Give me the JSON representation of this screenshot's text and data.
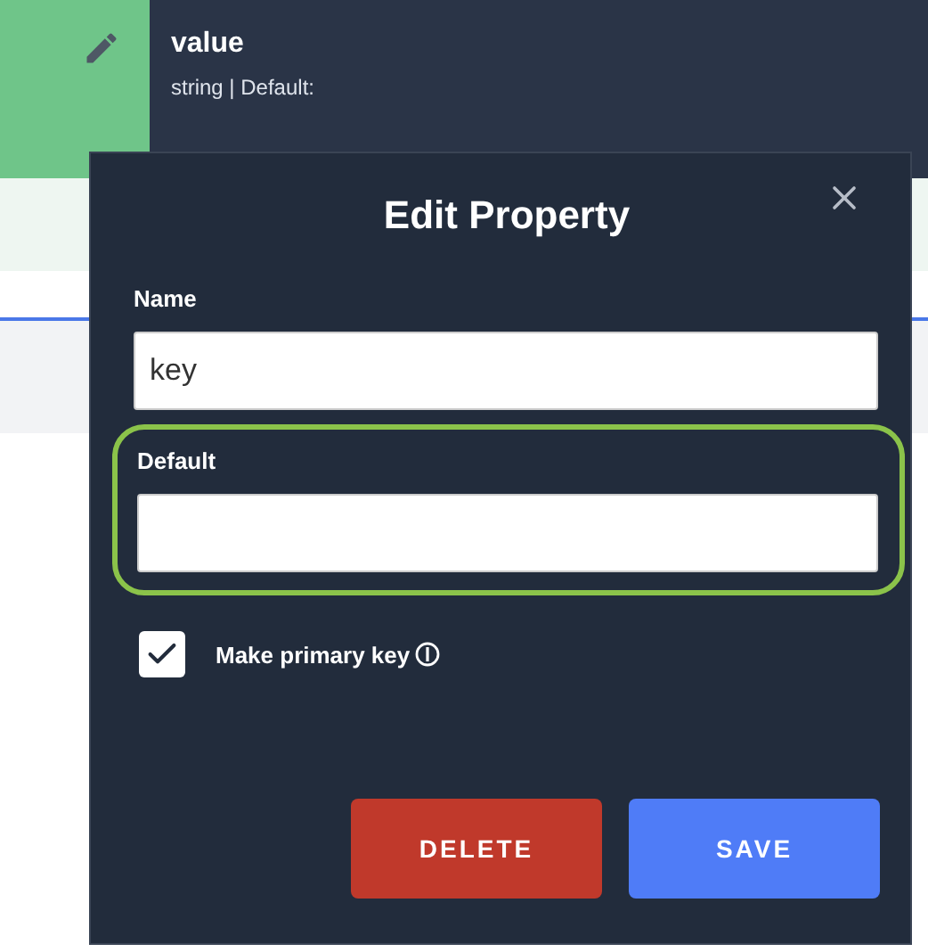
{
  "property_row": {
    "name": "value",
    "details": "string | Default:"
  },
  "dialog": {
    "title": "Edit Property",
    "fields": [
      {
        "label": "Name",
        "value": "key",
        "highlighted": false
      },
      {
        "label": "Default",
        "highlighted": true
      }
    ],
    "checkbox": {
      "label": "Make primary key",
      "checked": true
    },
    "buttons": [
      {
        "label": "DELETE",
        "kind": "danger"
      },
      {
        "label": "SAVE",
        "kind": "primary"
      }
    ]
  }
}
